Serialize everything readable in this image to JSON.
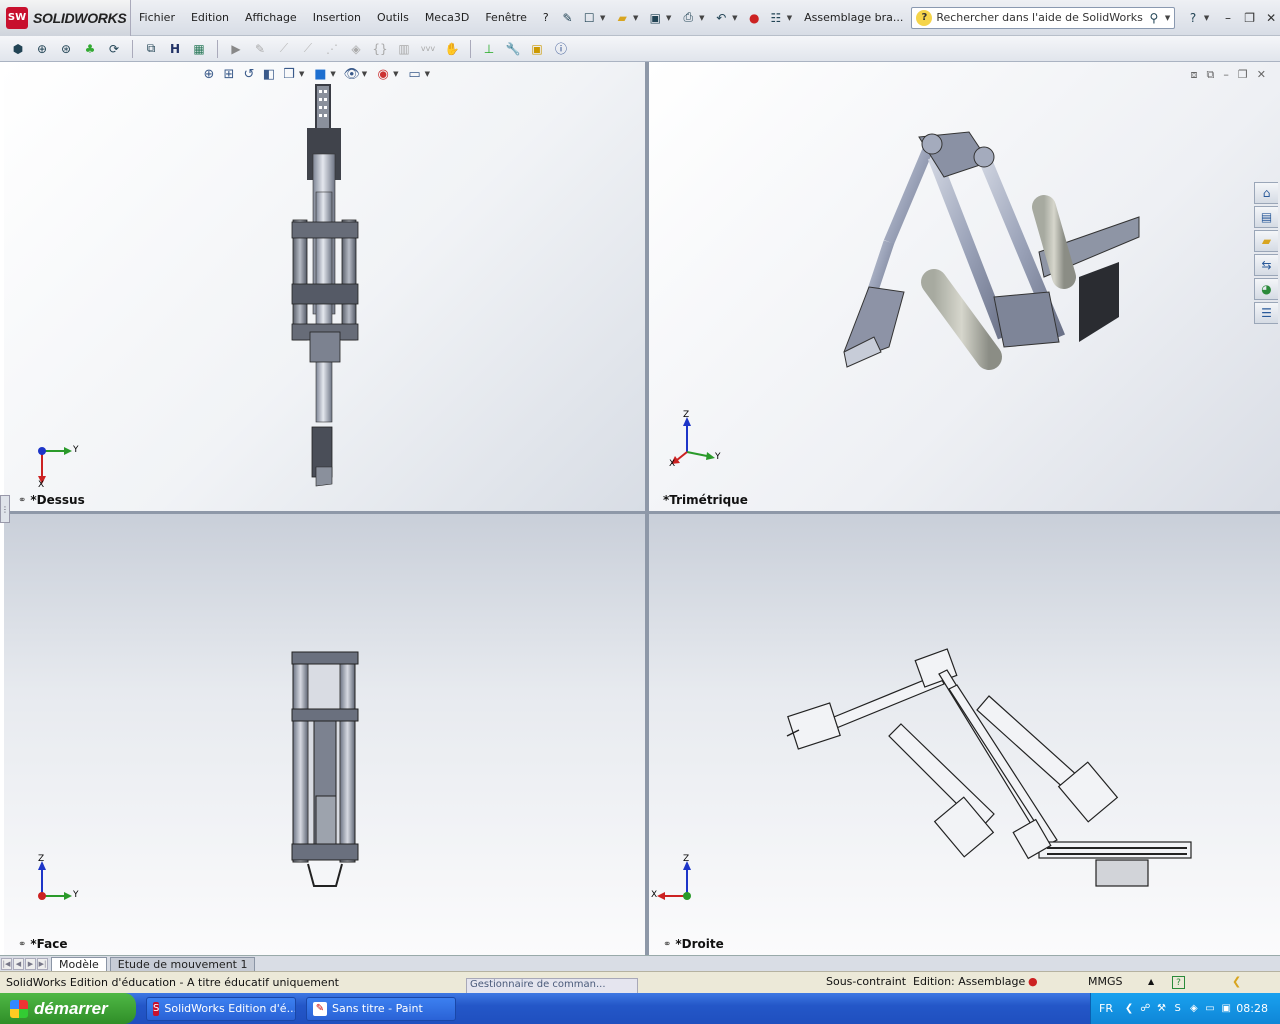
{
  "app": {
    "logo_text": "SOLIDWORKS",
    "doc_title": "Assemblage bra..."
  },
  "menu": [
    "Fichier",
    "Edition",
    "Affichage",
    "Insertion",
    "Outils",
    "Meca3D",
    "Fenêtre",
    "?"
  ],
  "search": {
    "placeholder": "Rechercher dans l'aide de SolidWorks"
  },
  "viewports": {
    "top_left": {
      "label": "*Dessus",
      "triad": {
        "h": "Y",
        "v": "X"
      }
    },
    "top_right": {
      "label": "*Trimétrique",
      "triad": {
        "z": "Z",
        "x": "X",
        "y": "Y"
      }
    },
    "bottom_left": {
      "label": "*Face",
      "triad": {
        "h": "Y",
        "v": "Z"
      }
    },
    "bottom_right": {
      "label": "*Droite",
      "triad": {
        "h": "X",
        "v": "Z"
      }
    }
  },
  "tabs": [
    "Modèle",
    "Etude de mouvement 1"
  ],
  "status": {
    "left": "SolidWorks Edition d'éducation - A titre éducatif uniquement",
    "command_manager": "Gestionnaire de comman...",
    "constraint": "Sous-contraint",
    "edition": "Edition: Assemblage",
    "units": "MMGS"
  },
  "taskbar": {
    "start": "démarrer",
    "tasks": [
      "SolidWorks Edition d'é...",
      "Sans titre - Paint"
    ],
    "lang": "FR",
    "clock": "08:28"
  },
  "colors": {
    "accent": "#c8102e",
    "taskbar": "#2457c8",
    "start": "#3aa232"
  }
}
